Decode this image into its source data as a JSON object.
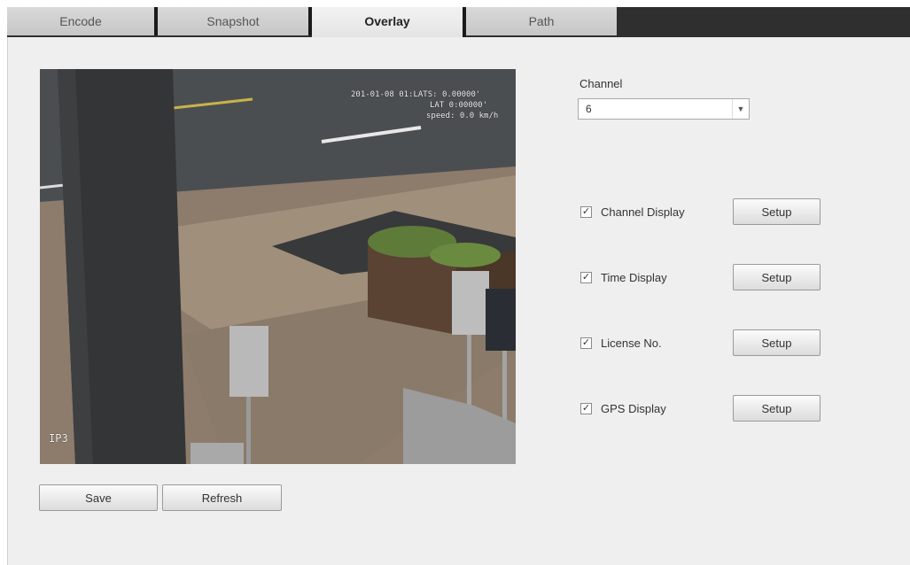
{
  "tabs": [
    {
      "label": "Encode",
      "active": false
    },
    {
      "label": "Snapshot",
      "active": false
    },
    {
      "label": "Overlay",
      "active": true
    },
    {
      "label": "Path",
      "active": false
    }
  ],
  "preview": {
    "overlay_time": "20",
    "overlay_time_rest": "1-01-08 01:LATS: 0.00000'",
    "overlay_lat": "LAT 0:00000'",
    "overlay_speed": "speed: 0.0 km/h",
    "overlay_channel": "IP3"
  },
  "channel": {
    "label": "Channel",
    "value": "6"
  },
  "options": [
    {
      "label": "Channel Display",
      "checked": true,
      "button": "Setup"
    },
    {
      "label": "Time Display",
      "checked": true,
      "button": "Setup"
    },
    {
      "label": "License No.",
      "checked": true,
      "button": "Setup"
    },
    {
      "label": "GPS Display",
      "checked": true,
      "button": "Setup"
    }
  ],
  "actions": {
    "save": "Save",
    "refresh": "Refresh"
  },
  "checkmark": "✓"
}
